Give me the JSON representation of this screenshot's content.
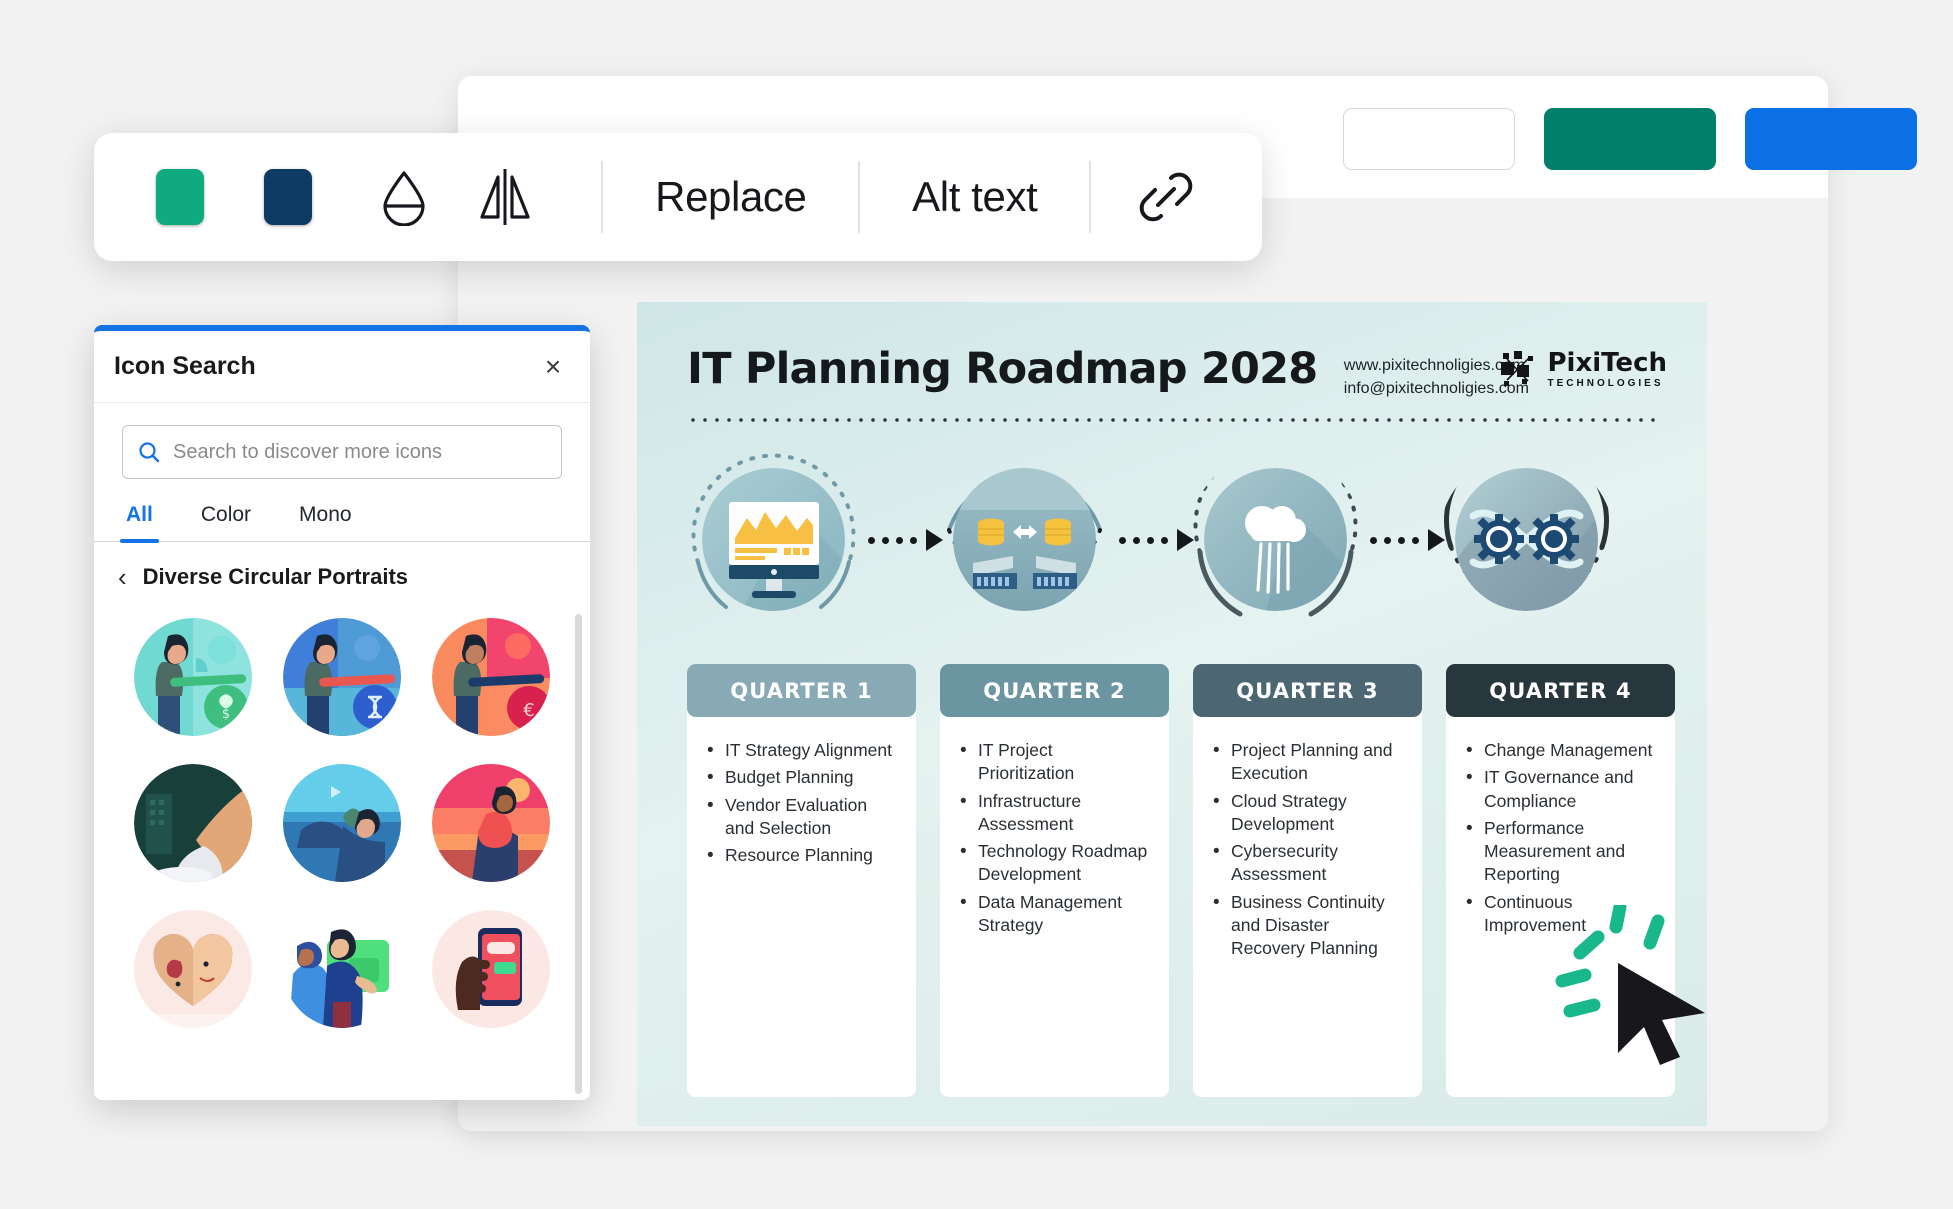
{
  "image_toolbar": {
    "swatch_primary": "#0faa80",
    "swatch_secondary": "#0d3b63",
    "opacity_icon": "droplet-icon",
    "flip_icon": "flip-horizontal-icon",
    "replace_label": "Replace",
    "alt_text_label": "Alt text",
    "link_icon": "link-icon"
  },
  "editor_header": {
    "buttons": [
      {
        "name": "ghost-button",
        "label": "",
        "color": "#ffffff"
      },
      {
        "name": "present-button",
        "label": "",
        "color": "#00806b"
      },
      {
        "name": "share-button",
        "label": "",
        "color": "#0b6fe5"
      }
    ]
  },
  "icon_panel": {
    "title": "Icon Search",
    "close_label": "×",
    "search": {
      "placeholder": "Search to discover more icons",
      "value": "",
      "icon": "search-icon"
    },
    "tabs": [
      {
        "label": "All",
        "active": true
      },
      {
        "label": "Color",
        "active": false
      },
      {
        "label": "Mono",
        "active": false
      }
    ],
    "breadcrumb": {
      "back_icon": "chevron-left-icon",
      "label": "Diverse Circular Portraits"
    },
    "icons": [
      {
        "name": "portrait-budget-plant",
        "c1": "#7ce0d8",
        "c2": "#4fc4c9",
        "badge": "#35c06b"
      },
      {
        "name": "portrait-hourglass",
        "c1": "#4f86e0",
        "c2": "#2f6bd6",
        "badge": "#2f5fd0"
      },
      {
        "name": "portrait-coin-sunset",
        "c1": "#f97b6d",
        "c2": "#ef4f6e",
        "badge": "#e03a5f"
      },
      {
        "name": "portrait-sneaker-city",
        "c1": "#2f6b5e",
        "c2": "#14403c",
        "badge": "#cbd5d2"
      },
      {
        "name": "portrait-beach-wave",
        "c1": "#5ec8e8",
        "c2": "#2a6fb0",
        "badge": "#1f4f80"
      },
      {
        "name": "portrait-sunset-sitting",
        "c1": "#fb8b63",
        "c2": "#ec4f6a",
        "badge": "#c0392b"
      },
      {
        "name": "portrait-heart-faces",
        "c1": "#fbe7e4",
        "c2": "#f7d9d5",
        "badge": "#e05a5a"
      },
      {
        "name": "portrait-couple-green",
        "c1": "#ffffff",
        "c2": "#ffffff",
        "badge": "#4ee07a"
      },
      {
        "name": "portrait-phone-hand",
        "c1": "#fbe7e4",
        "c2": "#f6ded9",
        "badge": "#ef4f5e"
      }
    ]
  },
  "roadmap": {
    "title": "IT Planning Roadmap 2028",
    "website": "www.pixitechnoligies.com",
    "email": "info@pixitechnoligies.com",
    "logo_name": "PixiTech",
    "logo_sub": "TECHNOLOGIES",
    "nodes": [
      {
        "name": "monitor-chart-icon",
        "ring": "solid-top"
      },
      {
        "name": "database-transfer-icon",
        "ring": "solid-top"
      },
      {
        "name": "cloud-rain-icon",
        "ring": "dotted-top"
      },
      {
        "name": "infinity-gears-icon",
        "ring": "solid-top"
      }
    ],
    "quarters": [
      {
        "label": "QUARTER 1",
        "color": "#87aab5",
        "items": [
          "IT Strategy Alignment",
          "Budget Planning",
          "Vendor Evaluation and Selection",
          "Resource Planning"
        ]
      },
      {
        "label": "QUARTER 2",
        "color": "#6b95a1",
        "items": [
          "IT Project Prioritization",
          "Infrastructure Assessment",
          "Technology Roadmap Development",
          "Data Management Strategy"
        ]
      },
      {
        "label": "QUARTER 3",
        "color": "#4d6772",
        "items": [
          "Project Planning and Execution",
          "Cloud Strategy Development",
          "Cybersecurity Assessment",
          "Business Continuity and Disaster Recovery Planning"
        ]
      },
      {
        "label": "QUARTER 4",
        "color": "#28373d",
        "items": [
          "Change Management",
          "IT Governance and Compliance",
          "Performance Measurement and Reporting",
          "Continuous Improvement"
        ]
      }
    ]
  },
  "cursor": {
    "name": "mouse-cursor",
    "burst_color": "#19b78c"
  }
}
